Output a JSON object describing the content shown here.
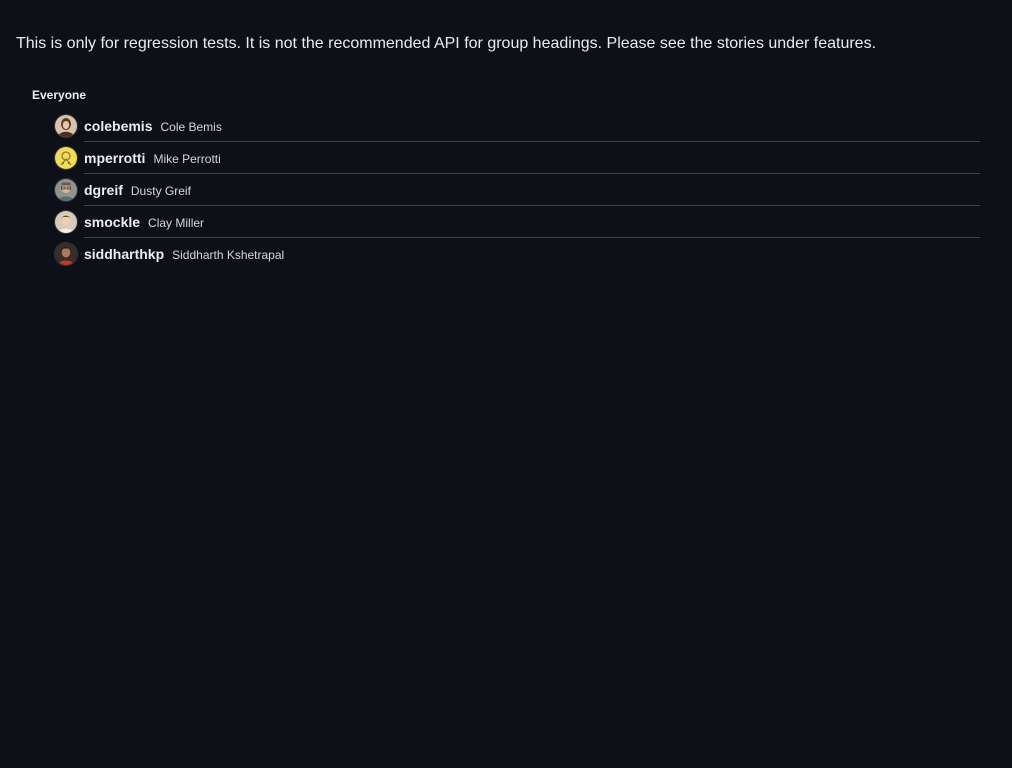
{
  "note": "This is only for regression tests. It is not the recommended API for group headings. Please see the stories under features.",
  "group": {
    "heading": "Everyone",
    "users": [
      {
        "username": "colebemis",
        "fullname": "Cole Bemis",
        "avatar_icon": "avatar-colebemis",
        "avatar_color": "#b48a78"
      },
      {
        "username": "mperrotti",
        "fullname": "Mike Perrotti",
        "avatar_icon": "avatar-mperrotti",
        "avatar_color": "#e8d24a"
      },
      {
        "username": "dgreif",
        "fullname": "Dusty Greif",
        "avatar_icon": "avatar-dgreif",
        "avatar_color": "#9a9a8e"
      },
      {
        "username": "smockle",
        "fullname": "Clay Miller",
        "avatar_icon": "avatar-smockle",
        "avatar_color": "#c7b9a4"
      },
      {
        "username": "siddharthkp",
        "fullname": "Siddharth Kshetrapal",
        "avatar_icon": "avatar-siddharthkp",
        "avatar_color": "#6b4a3c"
      }
    ]
  }
}
